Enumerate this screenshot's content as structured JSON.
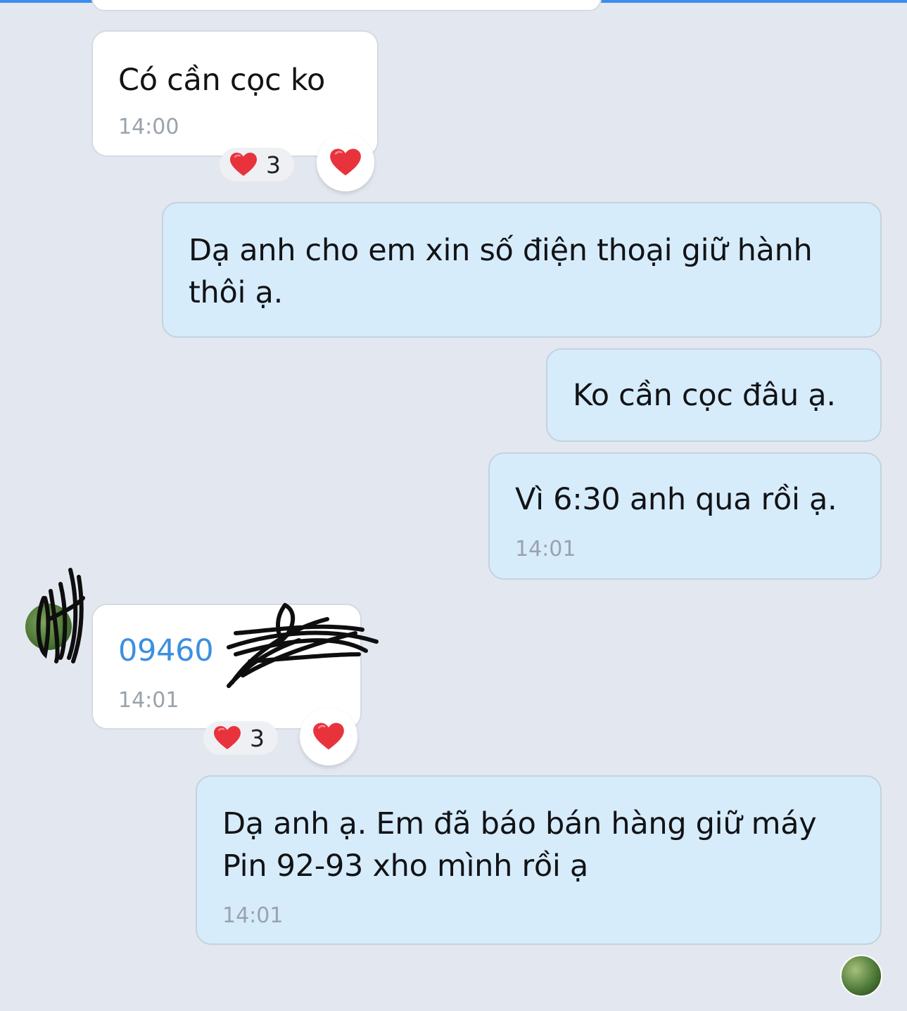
{
  "colors": {
    "background": "#e3e7ef",
    "incoming_bubble": "#ffffff",
    "outgoing_bubble": "#d7ecfb",
    "link": "#3c8fe0",
    "timestamp": "#9aa2ac",
    "heart": "#e8333d"
  },
  "messages": [
    {
      "id": "m1",
      "direction": "incoming",
      "text": "Có cần cọc ko",
      "time": "14:00",
      "reaction_icon": "heart-icon",
      "reaction_count": "3"
    },
    {
      "id": "m2",
      "direction": "outgoing",
      "line1": "Dạ anh cho em xin số điện thoại giữ hành",
      "line2": "thôi ạ."
    },
    {
      "id": "m3",
      "direction": "outgoing",
      "text": "Ko cần cọc đâu ạ."
    },
    {
      "id": "m4",
      "direction": "outgoing",
      "text": "Vì 6:30 anh qua rồi ạ.",
      "time": "14:01"
    },
    {
      "id": "m5",
      "direction": "incoming",
      "phone": "09460",
      "phone_redacted": true,
      "time": "14:01",
      "reaction_icon": "heart-icon",
      "reaction_count": "3"
    },
    {
      "id": "m6",
      "direction": "outgoing",
      "line1": "Dạ anh ạ. Em đã báo bán hàng giữ máy",
      "line2": "Pin 92-93 xho mình rồi ạ",
      "time": "14:01"
    }
  ]
}
